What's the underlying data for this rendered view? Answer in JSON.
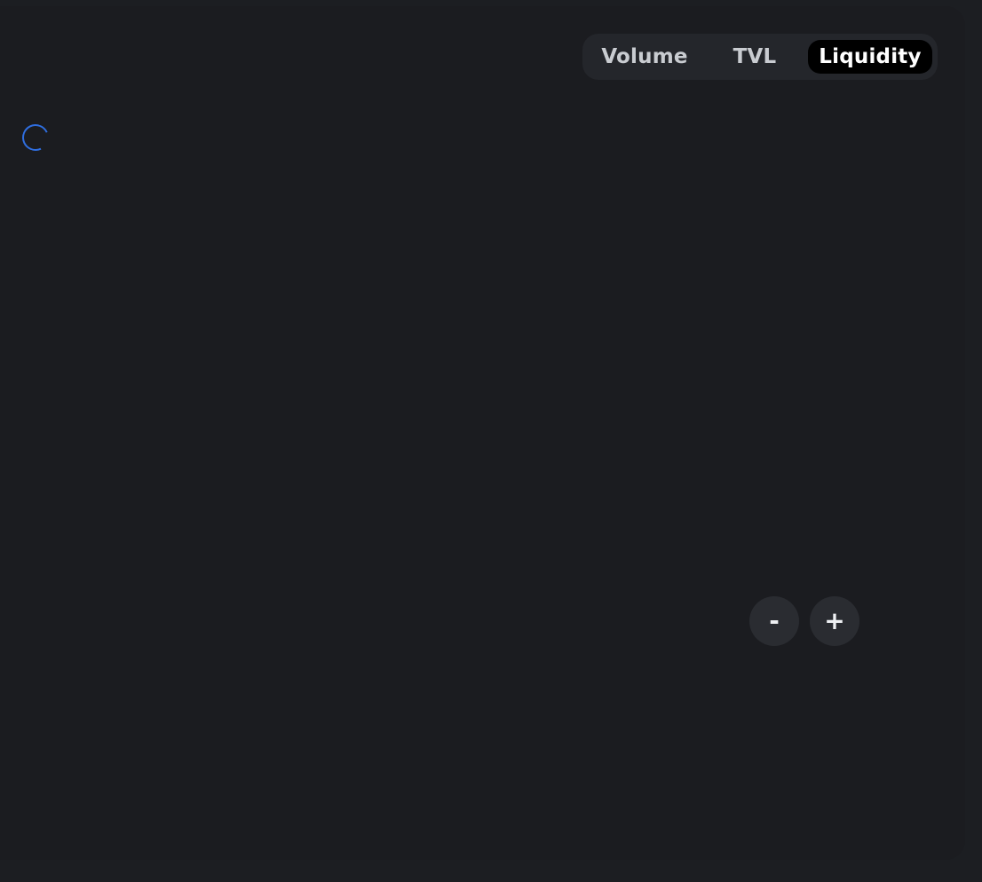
{
  "chart_tabs": {
    "volume_label": "Volume",
    "tvl_label": "TVL",
    "liquidity_label": "Liquidity",
    "selected": "Liquidity"
  },
  "loading": {
    "spinner_icon": "loading-spinner-icon",
    "color": "#2f6ee0"
  },
  "zoom": {
    "zoom_out_label": "-",
    "zoom_in_label": "+"
  },
  "colors": {
    "background": "#1c1e22",
    "card": "#1b1c20",
    "segment_bg": "#24262b",
    "active_tab": "#000000"
  }
}
